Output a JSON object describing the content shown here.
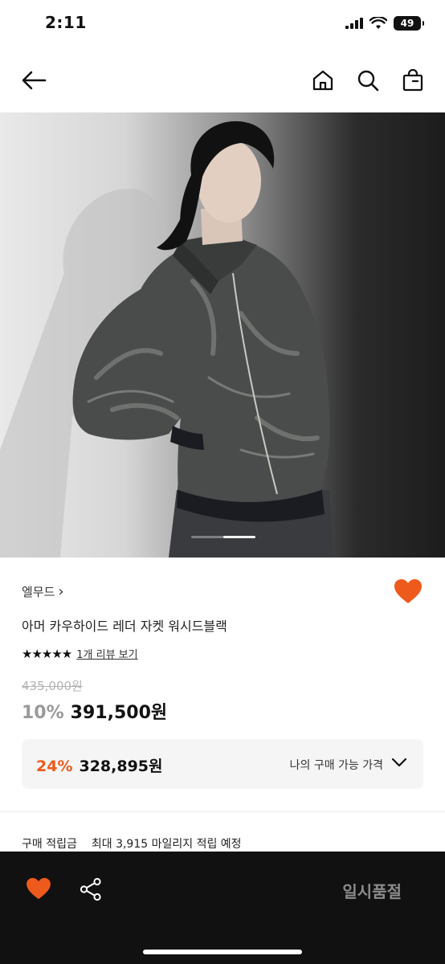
{
  "status_bar": {
    "time": "2:11",
    "battery": "49"
  },
  "nav": {
    "back_icon": "arrow-left-icon",
    "home_icon": "home-icon",
    "search_icon": "search-icon",
    "bag_icon": "shopping-bag-icon"
  },
  "product": {
    "brand": "엘무드",
    "brand_chevron": "›",
    "name": "아머 카우하이드 레더 자켓 워시드블랙",
    "rating_stars": "★★★★★",
    "rating": 5,
    "review_link": "1개 리뷰 보기",
    "original_price": "435,000원",
    "discount": "10%",
    "price": "391,500원",
    "wishlisted": true
  },
  "my_price": {
    "discount": "24%",
    "price": "328,895원",
    "label": "나의 구매 가능 가격"
  },
  "points": {
    "label": "구매 적립금",
    "value": "최대 3,915 마일리지 적립 예정"
  },
  "bottom_bar": {
    "status_label": "일시품절"
  },
  "colors": {
    "accent": "#ee5a1c",
    "bottom_bar": "#111111",
    "price_box": "#f5f5f5"
  },
  "carousel": {
    "total": 2,
    "current": 2
  }
}
